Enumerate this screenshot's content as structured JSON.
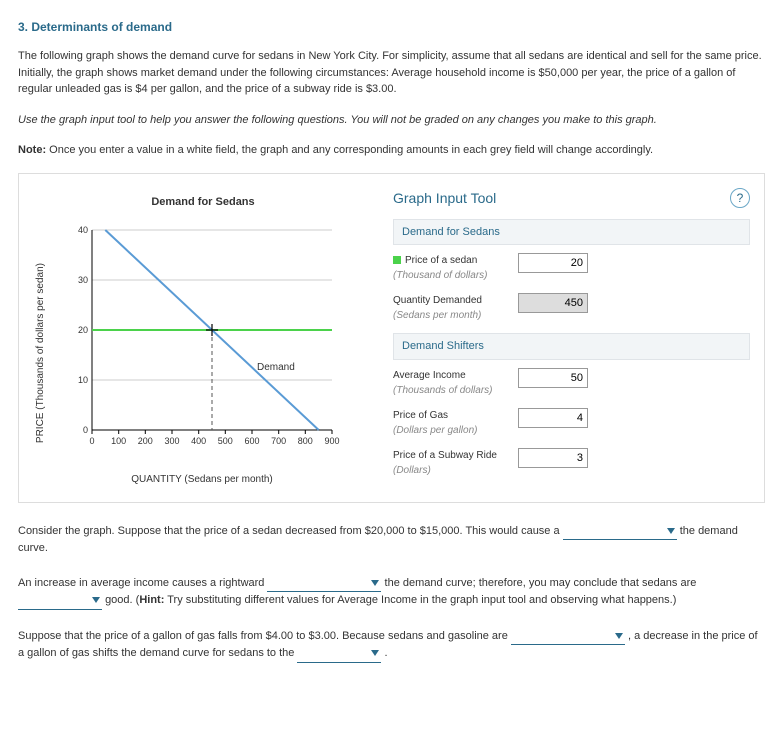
{
  "heading": "3. Determinants of demand",
  "intro": "The following graph shows the demand curve for sedans in New York City. For simplicity, assume that all sedans are identical and sell for the same price. Initially, the graph shows market demand under the following circumstances: Average household income is $50,000 per year, the price of a gallon of regular unleaded gas is $4 per gallon, and the price of a subway ride is $3.00.",
  "instruction": "Use the graph input tool to help you answer the following questions. You will not be graded on any changes you make to this graph.",
  "note_label": "Note:",
  "note_text": " Once you enter a value in a white field, the graph and any corresponding amounts in each grey field will change accordingly.",
  "chart": {
    "title": "Demand for Sedans",
    "ylabel": "PRICE (Thousands of dollars per sedan)",
    "xlabel": "QUANTITY (Sedans per month)",
    "series_label": "Demand"
  },
  "chart_data": {
    "type": "line",
    "title": "Demand for Sedans",
    "xlabel": "QUANTITY (Sedans per month)",
    "ylabel": "PRICE (Thousands of dollars per sedan)",
    "xlim": [
      0,
      900
    ],
    "ylim": [
      0,
      40
    ],
    "xticks": [
      0,
      100,
      200,
      300,
      400,
      500,
      600,
      700,
      800,
      900
    ],
    "yticks": [
      0,
      10,
      20,
      30,
      40
    ],
    "series": [
      {
        "name": "Demand",
        "color": "#5a9bd5",
        "x": [
          50,
          850
        ],
        "y": [
          40,
          0
        ]
      }
    ],
    "guides": {
      "horizontal_price": 20,
      "vertical_quantity": 450
    }
  },
  "tool": {
    "header": "Graph Input Tool",
    "section1": "Demand for Sedans",
    "price_label": "Price of a sedan",
    "price_sub": "(Thousand of dollars)",
    "price_value": "20",
    "qty_label": "Quantity Demanded",
    "qty_sub": "(Sedans per month)",
    "qty_value": "450",
    "section2": "Demand Shifters",
    "income_label": "Average Income",
    "income_sub": "(Thousands of dollars)",
    "income_value": "50",
    "gas_label": "Price of Gas",
    "gas_sub": "(Dollars per gallon)",
    "gas_value": "4",
    "subway_label": "Price of a Subway Ride",
    "subway_sub": "(Dollars)",
    "subway_value": "3"
  },
  "q1": {
    "a": "Consider the graph. Suppose that the price of a sedan decreased from $20,000 to $15,000. This would cause a ",
    "b": " the demand curve."
  },
  "q2": {
    "a": "An increase in average income causes a rightward ",
    "b": " the demand curve; therefore, you may conclude that sedans are ",
    "c": " good. (",
    "hint_label": "Hint:",
    "hint_text": " Try substituting different values for Average Income in the graph input tool and observing what happens.)"
  },
  "q3": {
    "a": "Suppose that the price of a gallon of gas falls from $4.00 to $3.00. Because sedans and gasoline are ",
    "b": " , a decrease in the price of a gallon of gas shifts the demand curve for sedans to the ",
    "c": " ."
  }
}
